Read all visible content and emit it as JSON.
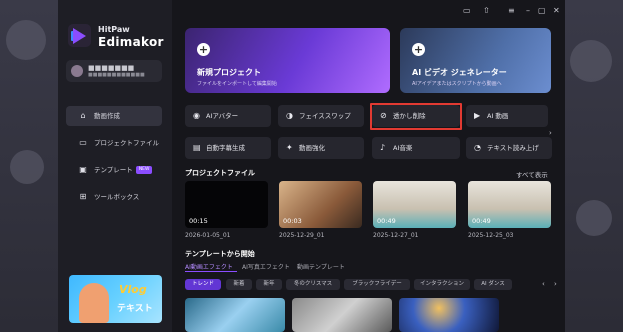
{
  "brand": {
    "name_small": "HitPaw",
    "name_large": "Edimakor"
  },
  "user": {
    "name": "■■■■■■■",
    "email": "■■■■■■■■■■■■"
  },
  "sidebar": {
    "items": [
      {
        "label": "動画作成",
        "icon": "home-icon",
        "active": true
      },
      {
        "label": "プロジェクトファイル",
        "icon": "folder-icon",
        "active": false
      },
      {
        "label": "テンプレート",
        "icon": "template-icon",
        "badge": "NEW",
        "active": false
      },
      {
        "label": "ツールボックス",
        "icon": "toolbox-icon",
        "active": false
      }
    ],
    "promo": {
      "title": "Vlog",
      "subtitle": "テキスト"
    }
  },
  "titlebar": {
    "icons": [
      "chat-icon",
      "upload-icon",
      "menu-icon",
      "minimize-icon",
      "maximize-icon",
      "close-icon"
    ]
  },
  "hero": [
    {
      "title": "新規プロジェクト",
      "subtitle": "ファイルをインポートして編集開始",
      "icon": "plus-icon"
    },
    {
      "title": "AI ビデオ ジェネレーター",
      "subtitle": "AIアイデアまたはスクリプトから動画へ",
      "icon": "plus-icon"
    }
  ],
  "tools_row1": [
    {
      "label": "AIアバター",
      "icon": "avatar-icon"
    },
    {
      "label": "フェイススワップ",
      "icon": "face-swap-icon"
    },
    {
      "label": "透かし削除",
      "icon": "watermark-remove-icon"
    },
    {
      "label": "AI 動画",
      "icon": "ai-video-icon"
    }
  ],
  "tools_row2": [
    {
      "label": "自動字幕生成",
      "icon": "cc-icon"
    },
    {
      "label": "動画強化",
      "icon": "enhance-icon"
    },
    {
      "label": "AI音楽",
      "icon": "music-icon"
    },
    {
      "label": "テキスト読み上げ",
      "icon": "tts-icon"
    }
  ],
  "projects": {
    "heading": "プロジェクトファイル",
    "see_all": "すべて表示",
    "items": [
      {
        "duration": "00:15",
        "date": "2026-01-05_01"
      },
      {
        "duration": "00:03",
        "date": "2025-12-29_01"
      },
      {
        "duration": "00:49",
        "date": "2025-12-27_01"
      },
      {
        "duration": "00:49",
        "date": "2025-12-25_03"
      }
    ]
  },
  "templates": {
    "heading": "テンプレートから開始",
    "tabs": [
      "AI動画エフェクト",
      "AI写真エフェクト",
      "動画テンプレート"
    ],
    "chips": [
      "トレンド",
      "新着",
      "新年",
      "冬のクリスマス",
      "ブラックフライデー",
      "インタラクション",
      "AI ダンス"
    ]
  },
  "colors": {
    "accent": "#8b4dff",
    "highlight": "#e23a32",
    "window": "#16161b"
  }
}
